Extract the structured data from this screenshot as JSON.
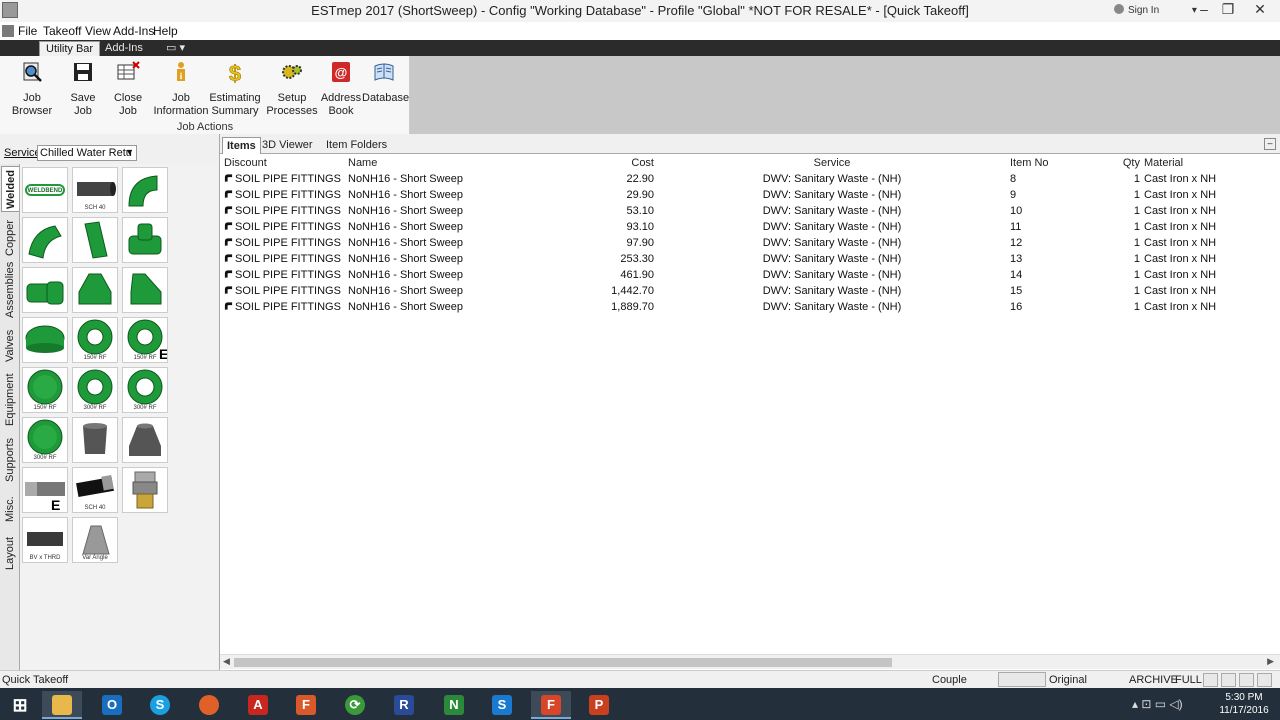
{
  "window": {
    "title": "ESTmep 2017 (ShortSweep) - Config \"Working Database\" - Profile \"Global\" *NOT FOR RESALE* - [Quick Takeoff]",
    "sign_in": "Sign In"
  },
  "menu": [
    "File",
    "Takeoff",
    "View",
    "Add-Ins",
    "Help"
  ],
  "ribbon_tabs": [
    "Utility Bar",
    "Add-Ins"
  ],
  "ribbon": {
    "buttons": [
      {
        "line1": "Job Browser",
        "line2": ""
      },
      {
        "line1": "Save Job",
        "line2": ""
      },
      {
        "line1": "Close Job",
        "line2": ""
      },
      {
        "line1": "Job",
        "line2": "Information"
      },
      {
        "line1": "Estimating",
        "line2": "Summary"
      },
      {
        "line1": "Setup",
        "line2": "Processes"
      },
      {
        "line1": "Address",
        "line2": "Book"
      },
      {
        "line1": "Database",
        "line2": ""
      }
    ],
    "group_label": "Job Actions"
  },
  "left_panel": {
    "service_label": "Service",
    "service_value": "Chilled Water Retu",
    "vertical_tabs": [
      "Welded",
      "Copper",
      "Assemblies",
      "Valves",
      "Equipment",
      "Supports",
      "Misc.",
      "Layout"
    ],
    "tiles": [
      {
        "caption": "WELDBEND",
        "icon": "weldbend-logo"
      },
      {
        "caption": "SCH 40",
        "icon": "pipe-icon"
      },
      {
        "caption": "",
        "icon": "elbow-90-icon"
      },
      {
        "caption": "",
        "icon": "elbow-45-icon"
      },
      {
        "caption": "",
        "icon": "lateral-icon"
      },
      {
        "caption": "",
        "icon": "tee-icon"
      },
      {
        "caption": "",
        "icon": "reducing-tee-icon"
      },
      {
        "caption": "",
        "icon": "concentric-reducer-icon"
      },
      {
        "caption": "",
        "icon": "eccentric-reducer-icon"
      },
      {
        "caption": "",
        "icon": "cap-icon"
      },
      {
        "caption": "150# RF",
        "icon": "flange-icon"
      },
      {
        "caption": "150# RF",
        "icon": "flange-e-icon"
      },
      {
        "caption": "150# RF",
        "icon": "blind-flange-icon"
      },
      {
        "caption": "300# RF",
        "icon": "flange-icon"
      },
      {
        "caption": "300# RF",
        "icon": "flange-icon"
      },
      {
        "caption": "300# RF",
        "icon": "blind-flange-icon"
      },
      {
        "caption": "",
        "icon": "coupling-icon"
      },
      {
        "caption": "",
        "icon": "reducer-icon"
      },
      {
        "caption": "",
        "icon": "nipple-e-icon"
      },
      {
        "caption": "SCH 40",
        "icon": "threaded-pipe-icon"
      },
      {
        "caption": "",
        "icon": "union-icon"
      },
      {
        "caption": "BV x THRD",
        "icon": "pipe-bevel-icon"
      },
      {
        "caption": "Var Angle",
        "icon": "var-angle-icon"
      }
    ]
  },
  "main_tabs": [
    "Items",
    "3D Viewer",
    "Item Folders"
  ],
  "grid": {
    "headers": [
      "Discount",
      "Name",
      "Cost",
      "Service",
      "Item No",
      "Qty",
      "Material"
    ],
    "rows": [
      [
        "SOIL PIPE FITTINGS",
        "NoNH16 - Short Sweep",
        "22.90",
        "DWV: Sanitary Waste - (NH)",
        "8",
        "1",
        "Cast Iron x NH"
      ],
      [
        "SOIL PIPE FITTINGS",
        "NoNH16 - Short Sweep",
        "29.90",
        "DWV: Sanitary Waste - (NH)",
        "9",
        "1",
        "Cast Iron x NH"
      ],
      [
        "SOIL PIPE FITTINGS",
        "NoNH16 - Short Sweep",
        "53.10",
        "DWV: Sanitary Waste - (NH)",
        "10",
        "1",
        "Cast Iron x NH"
      ],
      [
        "SOIL PIPE FITTINGS",
        "NoNH16 - Short Sweep",
        "93.10",
        "DWV: Sanitary Waste - (NH)",
        "11",
        "1",
        "Cast Iron x NH"
      ],
      [
        "SOIL PIPE FITTINGS",
        "NoNH16 - Short Sweep",
        "97.90",
        "DWV: Sanitary Waste - (NH)",
        "12",
        "1",
        "Cast Iron x NH"
      ],
      [
        "SOIL PIPE FITTINGS",
        "NoNH16 - Short Sweep",
        "253.30",
        "DWV: Sanitary Waste - (NH)",
        "13",
        "1",
        "Cast Iron x NH"
      ],
      [
        "SOIL PIPE FITTINGS",
        "NoNH16 - Short Sweep",
        "461.90",
        "DWV: Sanitary Waste - (NH)",
        "14",
        "1",
        "Cast Iron x NH"
      ],
      [
        "SOIL PIPE FITTINGS",
        "NoNH16 - Short Sweep",
        "1,442.70",
        "DWV: Sanitary Waste - (NH)",
        "15",
        "1",
        "Cast Iron x NH"
      ],
      [
        "SOIL PIPE FITTINGS",
        "NoNH16 - Short Sweep",
        "1,889.70",
        "DWV: Sanitary Waste - (NH)",
        "16",
        "1",
        "Cast Iron x NH"
      ]
    ]
  },
  "status_bar": {
    "left": "Quick Takeoff",
    "couple": "Couple",
    "original": "Original",
    "archive": "ARCHIVE",
    "full": "FULL"
  },
  "taskbar": {
    "apps": [
      "windows-start",
      "file-explorer",
      "outlook",
      "skype",
      "firefox",
      "acrobat",
      "estmep-fab",
      "sync",
      "revit",
      "navisworks",
      "skype-business",
      "fabrication-active",
      "powerpoint"
    ],
    "time": "5:30 PM",
    "date": "11/17/2016"
  },
  "colors": {
    "fitting_green": "#1f9a3a",
    "ribbon_dark": "#2b2b2b",
    "taskbar": "#23303c"
  }
}
